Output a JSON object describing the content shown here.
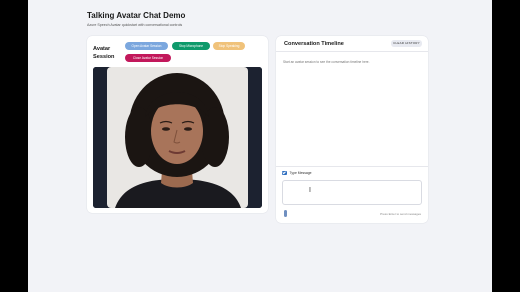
{
  "page": {
    "title": "Talking Avatar Chat Demo",
    "subtitle": "Azure Speech Avatar quickstart with conversational controls"
  },
  "avatar_panel": {
    "label": "Avatar Session",
    "buttons": {
      "open": "Open Avatar Session",
      "stop_microphone": "Stop Microphone",
      "stop_speaking": "Stop Speaking",
      "close": "Close Avatar Session"
    }
  },
  "chat_panel": {
    "title": "Conversation Timeline",
    "clear_label": "CLEAR HISTORY",
    "empty_text": "Start an avatar session to see the conversation timeline here.",
    "type_message_label": "Type Message",
    "type_message_checked": true,
    "input_value": "",
    "hint": "Press Enter to send messages"
  },
  "colors": {
    "open_button": "#7ba7de",
    "stop_microphone_button": "#0e9a6b",
    "stop_speaking_button": "#f0c27a",
    "close_button": "#c2185b"
  }
}
